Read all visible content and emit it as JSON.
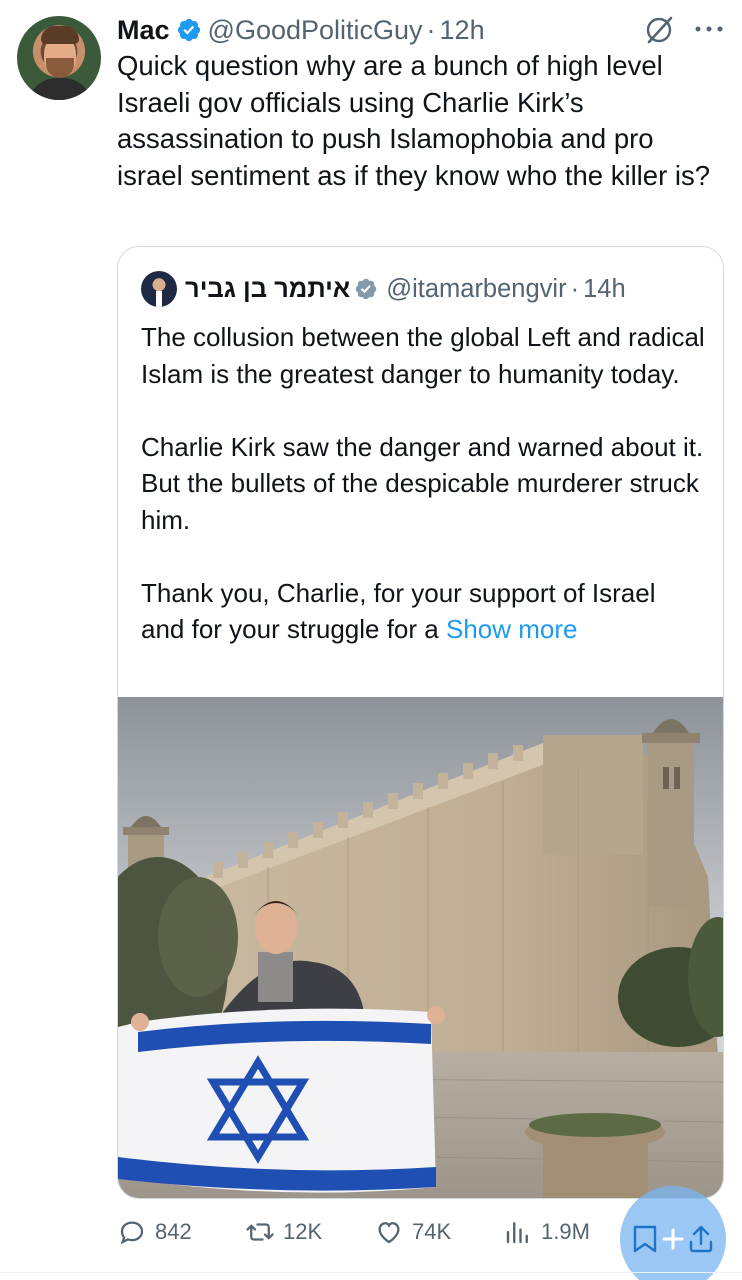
{
  "tweet": {
    "author_name": "Mac",
    "handle": "@GoodPoliticGuy",
    "separator": "·",
    "time": "12h",
    "text": "Quick question why are a bunch of high level Israeli gov officials using Charlie Kirk’s assassination to push Islamophobia and pro israel sentiment as if they know who the killer is?"
  },
  "quote": {
    "author_name": "איתמר בן גביר",
    "handle": "@itamarbengvir",
    "separator": "·",
    "time": "14h",
    "paragraphs": [
      "The collusion between the global Left and radical Islam is the greatest danger to humanity today.",
      "Charlie Kirk saw the danger and warned about it. But the bullets of the despicable murderer struck him.",
      "Thank you, Charlie, for your support of Israel and for your struggle for a"
    ],
    "show_more": "Show more"
  },
  "actions": {
    "replies": "842",
    "retweets": "12K",
    "likes": "74K",
    "views": "1.9M"
  },
  "icons": {
    "verified": "verified-badge-icon",
    "grok": "grok-icon",
    "more": "more-icon",
    "reply": "reply-icon",
    "retweet": "retweet-icon",
    "like": "heart-icon",
    "views": "views-icon",
    "bookmark": "bookmark-icon",
    "share": "share-icon"
  },
  "colors": {
    "verified_blue": "#1d9bf0",
    "secondary_text": "#536471",
    "border": "#cfd9de"
  }
}
